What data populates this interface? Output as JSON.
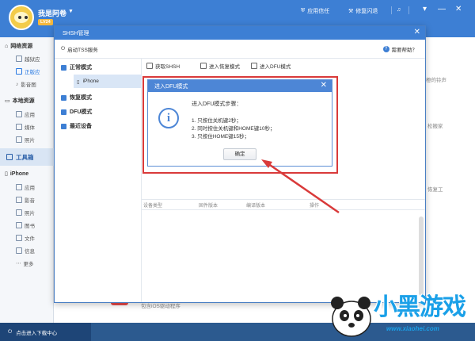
{
  "header": {
    "username": "我是阿卷",
    "vip_badge": "LV24",
    "trust_label": "应用信任",
    "repair_label": "修复闪退",
    "music_icon": "music-icon",
    "colors": {
      "bar": "#3d7fd4"
    }
  },
  "sidebar": {
    "groups": [
      {
        "label": "网络资源",
        "items": [
          "越狱应",
          "正版应",
          "影音图"
        ]
      },
      {
        "label": "本地资源",
        "items": [
          "应用",
          "媒体",
          "照片"
        ]
      },
      {
        "label": "工具箱",
        "items": []
      },
      {
        "label": "iPhone",
        "items": [
          "应用",
          "影音",
          "照片",
          "图书",
          "文件",
          "信息",
          "更多"
        ]
      }
    ]
  },
  "bottom": {
    "download_label": "点击进入下载中心"
  },
  "background": {
    "text1": "橙的铃声",
    "text2": "松搬家",
    "text3": "恢复工",
    "text4": "包含iOS驱动程序"
  },
  "shsh": {
    "title": "SHSH管理",
    "tss_label": "启动TSS服务",
    "help_label": "需要帮助？",
    "tree": {
      "normal": "正常模式",
      "device": "iPhone",
      "recovery": "恢复模式",
      "dfu": "DFU模式",
      "recent": "最近设备"
    },
    "actions": [
      "获取SHSH",
      "进入恢复模式",
      "进入DFU模式"
    ],
    "table_headers": [
      "设备类型",
      "固件版本",
      "编译版本",
      "操作"
    ]
  },
  "dfu_dialog": {
    "title": "进入DFU模式",
    "heading": "进入DFU模式步骤：",
    "steps": [
      "1. 只按住关机键2秒；",
      "2. 同时按住关机键和HOME键10秒；",
      "3. 只按住HOME键15秒；"
    ],
    "ok_label": "确定"
  },
  "watermark": {
    "logo_text": "小黑游戏",
    "url": "www.xiaohei.com"
  }
}
